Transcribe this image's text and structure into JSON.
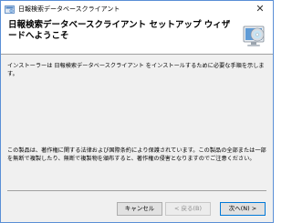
{
  "window": {
    "title": "日報検索データベースクライアント",
    "close_glyph": "✕"
  },
  "header": {
    "title": "日報検索データベースクライアント セットアップ ウィザードへようこそ",
    "icon": "setup-disc-computer-icon"
  },
  "content": {
    "intro": "インストーラーは 日報検索データベースクライアント をインストールするために必要な手順を示します。",
    "notice": "この製品は、著作権に関する法律および国際条約により保護されています。この製品の全部または一部を無断で複製したり、無断で複製物を頒布すると、著作権の侵害となりますのでご注意ください。"
  },
  "buttons": {
    "cancel": "キャンセル",
    "back": "< 戻る(B)",
    "next": "次へ(N) >"
  },
  "colors": {
    "window_border": "#5a8fd6",
    "panel_bg": "#f0f0f0",
    "default_button_border": "#0078d7"
  }
}
